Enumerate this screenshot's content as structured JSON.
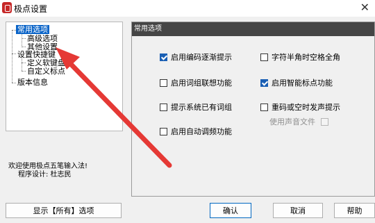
{
  "window": {
    "title": "极点设置",
    "close_glyph": "✕"
  },
  "tree": {
    "items": [
      {
        "label": "常用选项",
        "selected": true
      },
      {
        "label": "高级选项"
      },
      {
        "label": "其他设置"
      },
      {
        "label": "设置快捷键"
      },
      {
        "label": "定义软键盘"
      },
      {
        "label": "自定义标点"
      },
      {
        "label": "版本信息"
      }
    ]
  },
  "info": {
    "line1": "欢迎使用极点五笔输入法!",
    "line2": "程序设计: 杜志民"
  },
  "panel": {
    "header": "常用选项",
    "options": [
      {
        "label": "启用编码逐渐提示",
        "checked": true
      },
      {
        "label": "字符半角时空格全角",
        "checked": false
      },
      {
        "label": "启用词组联想功能",
        "checked": false
      },
      {
        "label": "启用智能标点功能",
        "checked": true
      },
      {
        "label": "提示系统已有词组",
        "checked": false
      },
      {
        "label": "重码或空时发声提示",
        "checked": false
      },
      {
        "label": "使用声音文件",
        "checked": false,
        "disabled": true
      },
      {
        "label": "启用自动调频功能",
        "checked": false
      }
    ]
  },
  "buttons": {
    "show_all": "显示【所有】选项",
    "ok": "确认",
    "cancel": "取消",
    "help": "帮助"
  },
  "colors": {
    "selection": "#0a64c8",
    "panel_header": "#454545",
    "annotation_arrow": "#e53935",
    "checkbox_checked": "#1a5fb4"
  }
}
